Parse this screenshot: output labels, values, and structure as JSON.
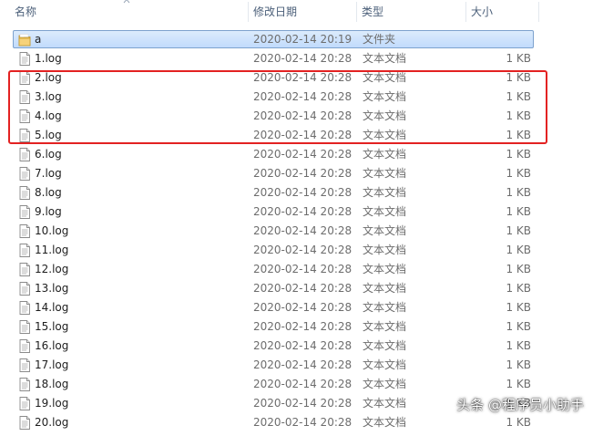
{
  "columns": {
    "name": "名称",
    "date": "修改日期",
    "type": "类型",
    "size": "大小"
  },
  "files": [
    {
      "name": "a",
      "date": "2020-02-14 20:19",
      "type": "文件夹",
      "size": "",
      "icon": "folder-icon",
      "selected": true
    },
    {
      "name": "1.log",
      "date": "2020-02-14 20:28",
      "type": "文本文档",
      "size": "1 KB",
      "icon": "text-file-icon"
    },
    {
      "name": "2.log",
      "date": "2020-02-14 20:28",
      "type": "文本文档",
      "size": "1 KB",
      "icon": "text-file-icon"
    },
    {
      "name": "3.log",
      "date": "2020-02-14 20:28",
      "type": "文本文档",
      "size": "1 KB",
      "icon": "text-file-icon"
    },
    {
      "name": "4.log",
      "date": "2020-02-14 20:28",
      "type": "文本文档",
      "size": "1 KB",
      "icon": "text-file-icon"
    },
    {
      "name": "5.log",
      "date": "2020-02-14 20:28",
      "type": "文本文档",
      "size": "1 KB",
      "icon": "text-file-icon"
    },
    {
      "name": "6.log",
      "date": "2020-02-14 20:28",
      "type": "文本文档",
      "size": "1 KB",
      "icon": "text-file-icon"
    },
    {
      "name": "7.log",
      "date": "2020-02-14 20:28",
      "type": "文本文档",
      "size": "1 KB",
      "icon": "text-file-icon"
    },
    {
      "name": "8.log",
      "date": "2020-02-14 20:28",
      "type": "文本文档",
      "size": "1 KB",
      "icon": "text-file-icon"
    },
    {
      "name": "9.log",
      "date": "2020-02-14 20:28",
      "type": "文本文档",
      "size": "1 KB",
      "icon": "text-file-icon"
    },
    {
      "name": "10.log",
      "date": "2020-02-14 20:28",
      "type": "文本文档",
      "size": "1 KB",
      "icon": "text-file-icon"
    },
    {
      "name": "11.log",
      "date": "2020-02-14 20:28",
      "type": "文本文档",
      "size": "1 KB",
      "icon": "text-file-icon"
    },
    {
      "name": "12.log",
      "date": "2020-02-14 20:28",
      "type": "文本文档",
      "size": "1 KB",
      "icon": "text-file-icon"
    },
    {
      "name": "13.log",
      "date": "2020-02-14 20:28",
      "type": "文本文档",
      "size": "1 KB",
      "icon": "text-file-icon"
    },
    {
      "name": "14.log",
      "date": "2020-02-14 20:28",
      "type": "文本文档",
      "size": "1 KB",
      "icon": "text-file-icon"
    },
    {
      "name": "15.log",
      "date": "2020-02-14 20:28",
      "type": "文本文档",
      "size": "1 KB",
      "icon": "text-file-icon"
    },
    {
      "name": "16.log",
      "date": "2020-02-14 20:28",
      "type": "文本文档",
      "size": "1 KB",
      "icon": "text-file-icon"
    },
    {
      "name": "17.log",
      "date": "2020-02-14 20:28",
      "type": "文本文档",
      "size": "1 KB",
      "icon": "text-file-icon"
    },
    {
      "name": "18.log",
      "date": "2020-02-14 20:28",
      "type": "文本文档",
      "size": "1 KB",
      "icon": "text-file-icon"
    },
    {
      "name": "19.log",
      "date": "2020-02-14 20:28",
      "type": "文本文档",
      "size": "1 KB",
      "icon": "text-file-icon"
    },
    {
      "name": "20.log",
      "date": "2020-02-14 20:28",
      "type": "文本文档",
      "size": "1 KB",
      "icon": "text-file-icon"
    }
  ],
  "annotation": {
    "color": "#e32222"
  },
  "watermark": "头条 @程序员小助手"
}
